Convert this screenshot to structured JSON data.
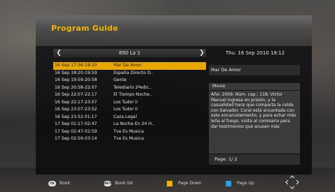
{
  "guide": {
    "title": "Program Guide",
    "channel": "850 La 1",
    "datetime": "Thu.  16 Sep 2010 18:12"
  },
  "events": [
    {
      "time": "16 Sep 17:36-18:20",
      "name": "Mar De Amor"
    },
    {
      "time": "16 Sep 18:20-19:59",
      "name": "España Directo D.."
    },
    {
      "time": "16 Sep 19:59-20:58",
      "name": "Gente"
    },
    {
      "time": "16 Sep 20:58-22:07",
      "name": "Telediario 2ªedic.."
    },
    {
      "time": "16 Sep 22:07-22:17",
      "name": "El Tiempo Noche.."
    },
    {
      "time": "16 Sep 22:17-23:07",
      "name": "Los Tudor Ii"
    },
    {
      "time": "16 Sep 23:07-23:52",
      "name": "Los Tudor Ii"
    },
    {
      "time": "16 Sep 23:52-01:17",
      "name": "Caza Legal"
    },
    {
      "time": "17 Sep 01:17-02:47",
      "name": "La Noche En 24 H.."
    },
    {
      "time": "17 Sep 02:47-02:59",
      "name": "Tve Es Musica"
    },
    {
      "time": "17 Sep 02:59-03:14",
      "name": "Tve Es Musica"
    }
  ],
  "selected_index": 0,
  "details": {
    "title": "Mar De Amor",
    "genre": "Movie",
    "description": "Año: 2009; Núm. cap.: 118; Víctor Manuel ingresa en prisión, y la casualidad hace que comparta la celda con Salvador. Coral está encantada con este encarcelamiento, y para echar más leña al fuego, visita al comisario para dar testimonios que acusan más",
    "page": "Page:  1/ 2"
  },
  "help": {
    "book_key": "OK",
    "book": "Book",
    "book_list_key": "INFO",
    "book_list": "Book list",
    "page_down": "Page Down",
    "page_up": "Page Up",
    "page_down_color": "#f0b400",
    "page_up_color": "#2aa0e0"
  },
  "icons": {
    "left_arrow": "chevron-left-icon",
    "right_arrow": "chevron-right-icon",
    "nav": "dpad-nav-icon"
  }
}
